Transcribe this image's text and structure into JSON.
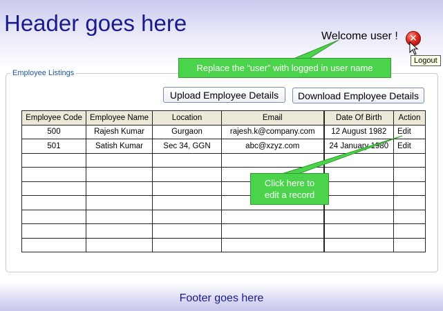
{
  "header": {
    "title": "Header goes here"
  },
  "user_bar": {
    "welcome_text": "Welcome user !",
    "logout_tooltip": "Logout",
    "logout_icon": "close-circle-icon"
  },
  "annotations": {
    "replace_user_note": "Replace the “user” with logged in user name",
    "edit_note_line1": "Click here to",
    "edit_note_line2": "edit a record",
    "callout_color": "#4cd34c"
  },
  "listing": {
    "legend": "Employee Listings",
    "upload_label": "Upload Employee Details",
    "download_label": "Download Employee Details",
    "columns": [
      "Employee Code",
      "Employee Name",
      "Location",
      "Email",
      "Date Of Birth",
      "Action"
    ],
    "rows": [
      [
        "500",
        "Rajesh Kumar",
        "Gurgaon",
        "rajesh.k@company.com",
        "12 August 1982",
        "Edit"
      ],
      [
        "501",
        "Satish Kumar",
        "Sec 34, GGN",
        "abc@xzyz.com",
        "24 January 1980",
        "Edit"
      ],
      [
        "",
        "",
        "",
        "",
        "",
        ""
      ],
      [
        "",
        "",
        "",
        "",
        "",
        ""
      ],
      [
        "",
        "",
        "",
        "",
        "",
        ""
      ],
      [
        "",
        "",
        "",
        "",
        "",
        ""
      ],
      [
        "",
        "",
        "",
        "",
        "",
        ""
      ],
      [
        "",
        "",
        "",
        "",
        "",
        ""
      ],
      [
        "",
        "",
        "",
        "",
        "",
        ""
      ]
    ]
  },
  "footer": {
    "text": "Footer goes here"
  }
}
